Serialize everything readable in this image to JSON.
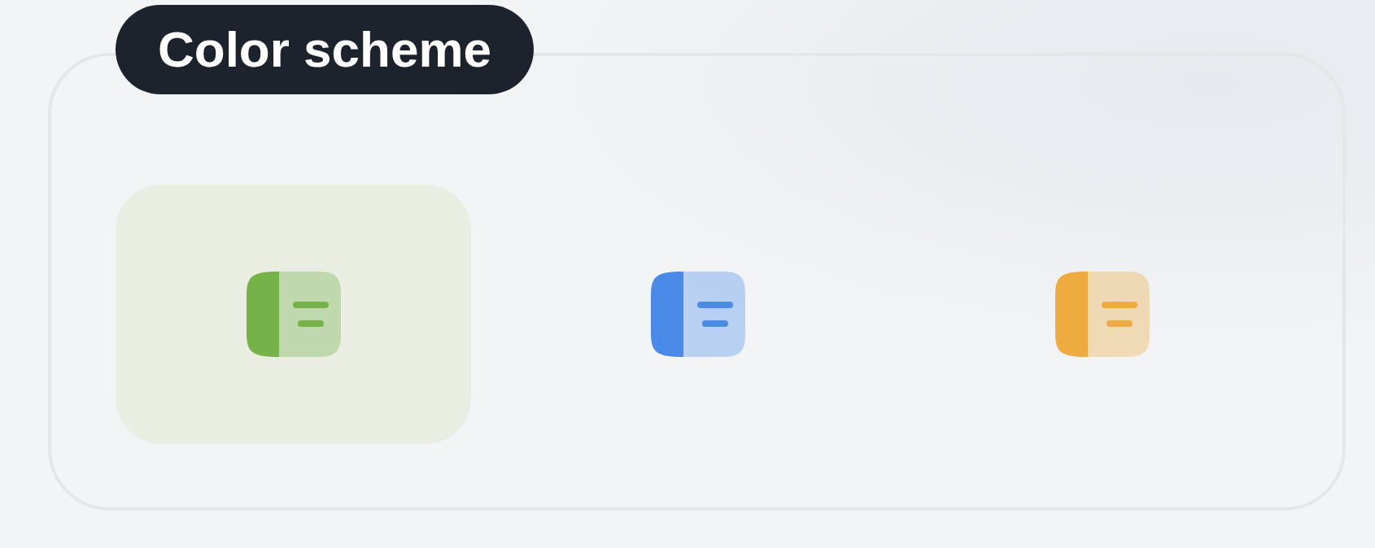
{
  "title": "Color scheme",
  "schemes": [
    {
      "color": "#76b24a",
      "selected": true
    },
    {
      "color": "#4a8bea",
      "selected": false
    },
    {
      "color": "#eeab40",
      "selected": false
    }
  ]
}
